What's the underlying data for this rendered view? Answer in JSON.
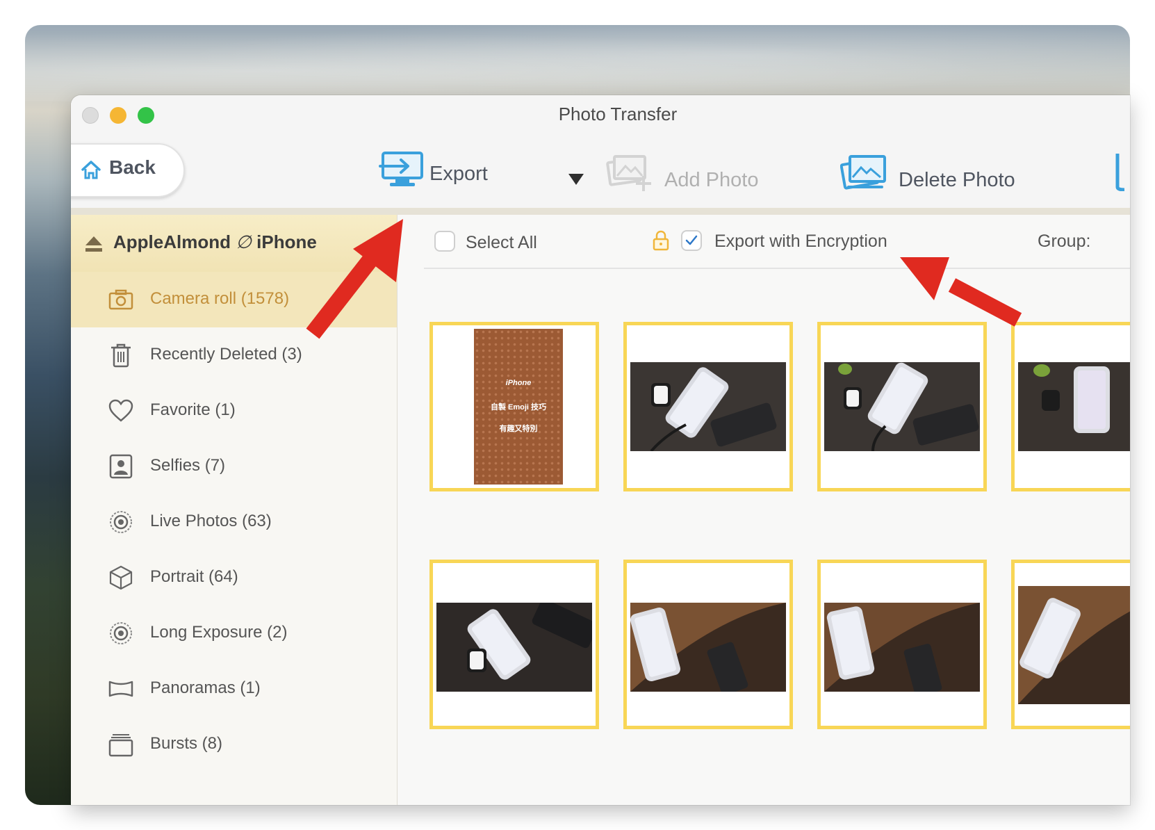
{
  "window": {
    "title": "Photo Transfer"
  },
  "toolbar": {
    "back_label": "Back",
    "export_label": "Export",
    "add_photo_label": "Add Photo",
    "delete_photo_label": "Delete Photo"
  },
  "sidebar": {
    "device_name": "AppleAlmond",
    "device_suffix": "iPhone",
    "items": [
      {
        "label": "Camera roll (1578)",
        "icon": "camera-icon",
        "active": true
      },
      {
        "label": "Recently Deleted (3)",
        "icon": "trash-icon"
      },
      {
        "label": "Favorite (1)",
        "icon": "heart-icon"
      },
      {
        "label": "Selfies (7)",
        "icon": "selfie-icon"
      },
      {
        "label": "Live Photos (63)",
        "icon": "live-photo-icon"
      },
      {
        "label": "Portrait (64)",
        "icon": "cube-icon"
      },
      {
        "label": "Long Exposure (2)",
        "icon": "long-exposure-icon"
      },
      {
        "label": "Panoramas (1)",
        "icon": "panorama-icon"
      },
      {
        "label": "Bursts (8)",
        "icon": "bursts-icon"
      }
    ]
  },
  "content": {
    "select_all_label": "Select All",
    "select_all_checked": false,
    "encryption_label": "Export with Encryption",
    "encryption_checked": true,
    "group_label": "Group:"
  },
  "thumbnails": {
    "poster_lines": [
      "iPhone",
      "自製 Emoji 技巧",
      "有趣又特別"
    ]
  },
  "colors": {
    "accent_yellow": "#f8d656",
    "active_text": "#c28f3a",
    "annotation_red": "#e02a20",
    "icon_blue": "#3aa0dc"
  }
}
